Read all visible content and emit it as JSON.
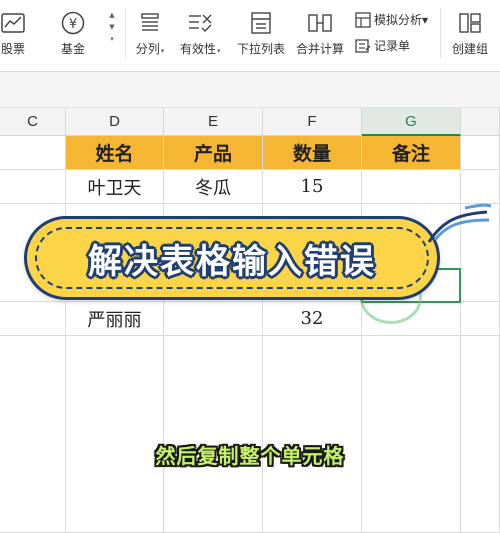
{
  "ribbon": {
    "stock_label": "股票",
    "fund_label": "基金",
    "split_label": "分列",
    "validity_label": "有效性",
    "dropdown_list_label": "下拉列表",
    "merge_calc_label": "合并计算",
    "simulation_label": "模拟分析",
    "record_label": "记录单",
    "create_group_label": "创建组",
    "fund_symbol": "¥"
  },
  "columns": [
    "C",
    "D",
    "E",
    "F",
    "G"
  ],
  "selected_column": "G",
  "table": {
    "headers": [
      "姓名",
      "产品",
      "数量",
      "备注"
    ],
    "rows": [
      {
        "name": "叶卫天",
        "product": "冬瓜",
        "qty": "15",
        "note": ""
      },
      {
        "name": "严丽丽",
        "product": "",
        "qty": "32",
        "note": ""
      }
    ]
  },
  "banner": {
    "text": "解决表格输入错误"
  },
  "subtitle": {
    "text": "然后复制整个单元格"
  },
  "colors": {
    "header_fill": "#f5b733",
    "banner_fill": "#fbd448",
    "banner_outline": "#1f3e73",
    "selection_green": "#2f9a54",
    "subtitle_green": "#c6f26a"
  },
  "icons": [
    "stock-icon",
    "fund-icon",
    "split-icon",
    "validity-icon",
    "dropdown-list-icon",
    "merge-calc-icon",
    "simulation-icon",
    "record-icon",
    "create-group-icon",
    "ribbon-curl-icon"
  ]
}
